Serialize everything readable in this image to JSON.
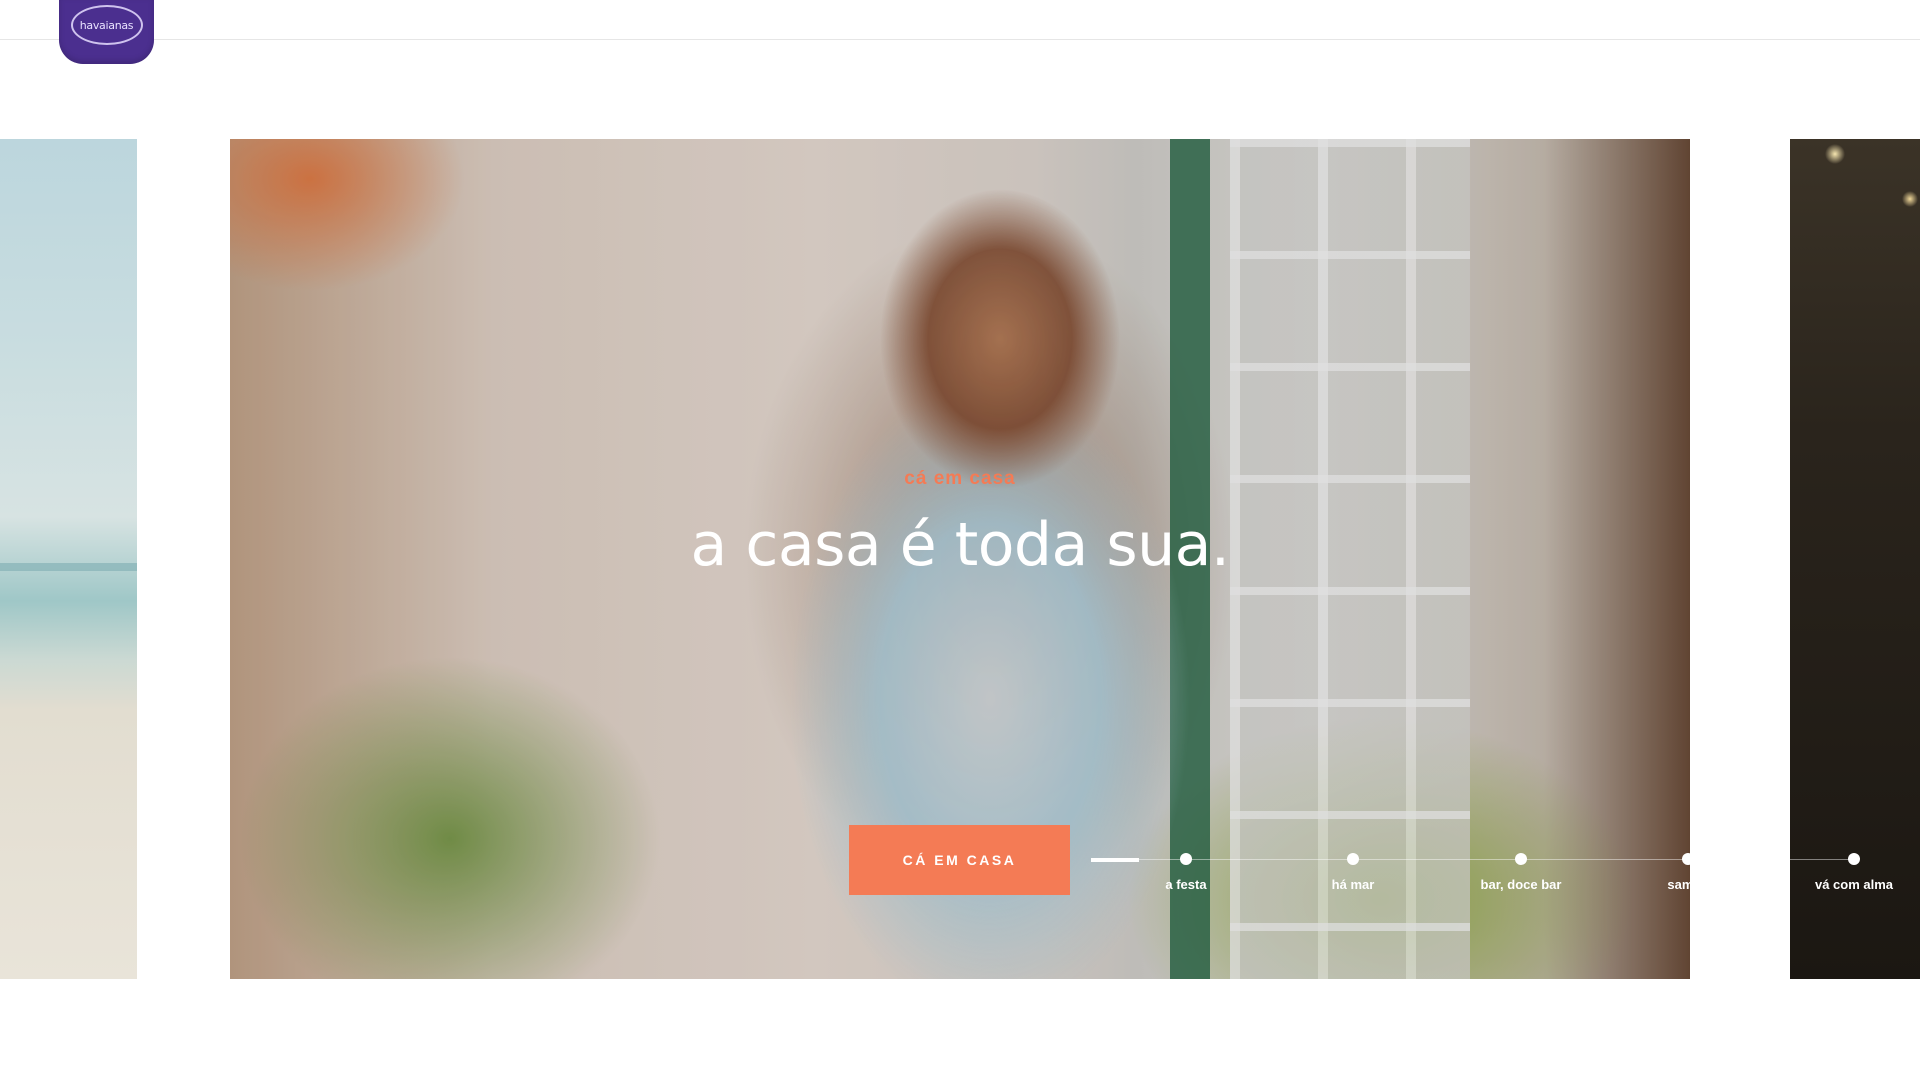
{
  "brand": {
    "logo_text": "havaianas",
    "color": "#4b2f8f"
  },
  "hero": {
    "kicker": "cá em casa",
    "headline": "a casa é toda sua.",
    "cta_label": "CÁ EM CASA",
    "accent_color": "#f47b55"
  },
  "nav": {
    "items": [
      {
        "label": "a festa"
      },
      {
        "label": "há mar"
      },
      {
        "label": "bar, doce bar"
      },
      {
        "label": "samba"
      },
      {
        "label": "vá com alma"
      }
    ]
  }
}
